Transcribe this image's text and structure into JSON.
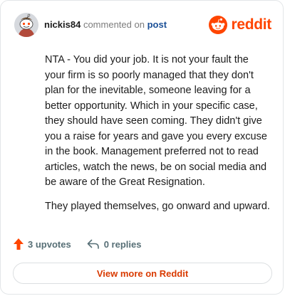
{
  "comment": {
    "username": "nickis84",
    "commented_text": "commented on",
    "post_link": "post",
    "paragraphs": [
      "NTA - You did your job. It is not your fault the your firm is so poorly managed that they don't plan for the inevitable, someone leaving for a better opportunity. Which in your specific case, they should have seen coming. They didn't give you a raise for years and gave you every excuse in the book. Management preferred not to read articles, watch the news, be on social media and be aware of the Great Resignation.",
      "They played themselves, go onward and upward."
    ]
  },
  "brand": {
    "name": "reddit",
    "color": "#ff4500"
  },
  "actions": {
    "upvotes": "3 upvotes",
    "replies": "0 replies"
  },
  "footer": {
    "view_more": "View more on Reddit"
  },
  "icons": {
    "avatar": "snoo-avatar-icon",
    "logo": "reddit-snoo-icon",
    "upvote": "upvote-arrow-icon",
    "reply": "reply-arrow-icon"
  }
}
